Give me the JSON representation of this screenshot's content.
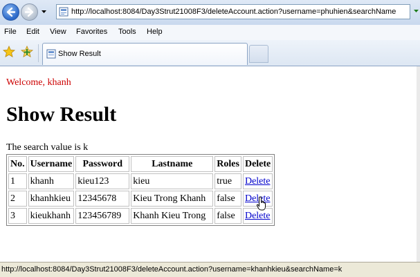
{
  "browser": {
    "address_url": "http://localhost:8084/Day3Strut21008F3/deleteAccount.action?username=phuhien&searchName",
    "menu": [
      "File",
      "Edit",
      "View",
      "Favorites",
      "Tools",
      "Help"
    ],
    "tab_title": "Show Result",
    "status_text": "http://localhost:8084/Day3Strut21008F3/deleteAccount.action?username=khanhkieu&searchName=k"
  },
  "page": {
    "welcome": "Welcome, khanh",
    "heading": "Show Result",
    "search_text": "The search value is k",
    "table": {
      "headers": [
        "No.",
        "Username",
        "Password",
        "Lastname",
        "Roles",
        "Delete"
      ],
      "rows": [
        [
          "1",
          "khanh",
          "kieu123",
          "kieu",
          "true",
          "Delete"
        ],
        [
          "2",
          "khanhkieu",
          "12345678",
          "Kieu Trong Khanh",
          "false",
          "Delete"
        ],
        [
          "3",
          "kieukhanh",
          "123456789",
          "Khanh Kieu Trong",
          "false",
          "Delete"
        ]
      ]
    }
  },
  "icons": {
    "back": "back-arrow-icon",
    "forward": "forward-arrow-icon",
    "favorites": "star-icon",
    "add_favorite": "add-favorite-icon",
    "pointer": "hand-pointer-icon"
  },
  "colors": {
    "welcome": "#cc0000",
    "link": "#0000cc",
    "nav_blue": "#2866c7"
  }
}
